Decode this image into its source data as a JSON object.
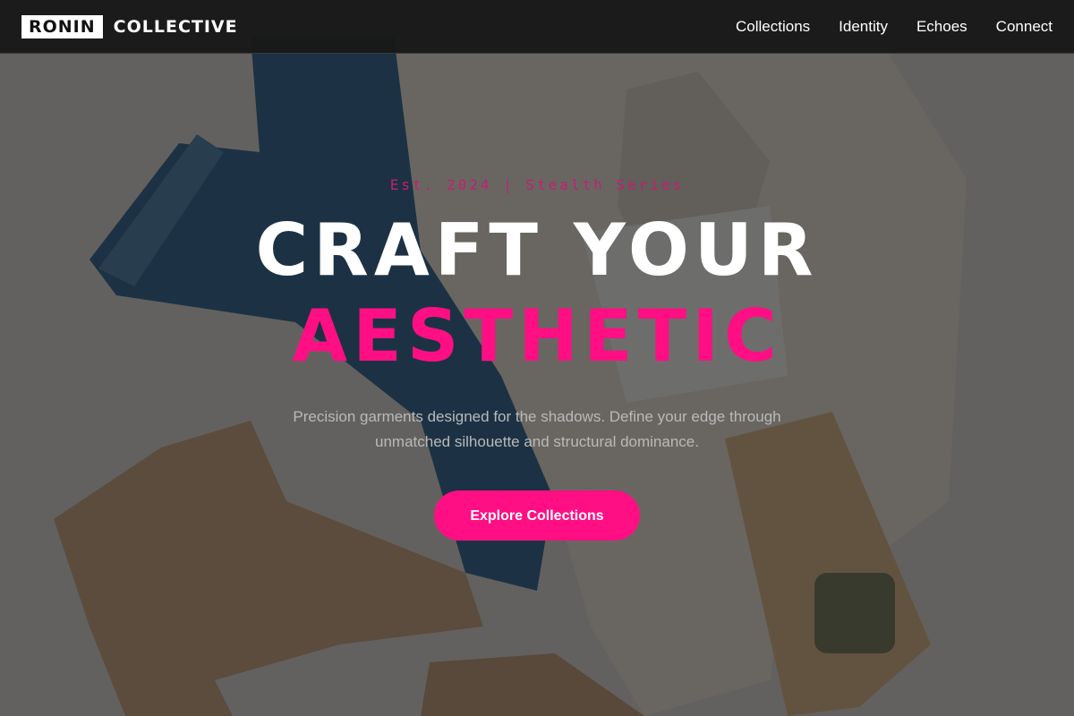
{
  "brand": {
    "box_text": "RONIN",
    "text": "COLLECTIVE"
  },
  "nav": {
    "items": [
      {
        "label": "Collections"
      },
      {
        "label": "Identity"
      },
      {
        "label": "Echoes"
      },
      {
        "label": "Connect"
      }
    ]
  },
  "hero": {
    "eyebrow": "Est. 2024 | Stealth Series",
    "headline_line1": "CRAFT YOUR",
    "headline_line2": "AESTHETIC",
    "subtext": "Precision garments designed for the shadows. Define your edge through unmatched silhouette and structural dominance.",
    "cta_label": "Explore Collections",
    "background_image": "flat-lay-clothing-photo"
  },
  "colors": {
    "accent": "#ff0f83",
    "navbar_bg": "#181818",
    "text_primary": "#ffffff",
    "text_muted": "#b9b9b9"
  }
}
